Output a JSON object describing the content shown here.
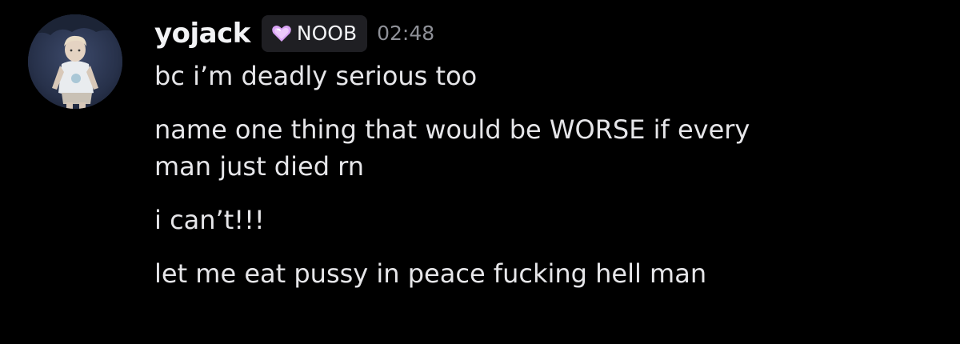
{
  "message": {
    "author": "yojack",
    "tag": {
      "label": "NOOB",
      "icon": "heart-gem-icon",
      "icon_color": "#d9a3f5"
    },
    "timestamp": "02:48",
    "lines": [
      "bc i’m deadly serious too",
      "name one thing that would be WORSE if every",
      "man just died rn",
      "i can’t!!!",
      "let me eat pussy in peace fucking hell man"
    ]
  },
  "colors": {
    "background": "#000000",
    "text": "#e6e6e9",
    "timestamp": "#8e9097",
    "tag_background": "#1f1f23"
  }
}
